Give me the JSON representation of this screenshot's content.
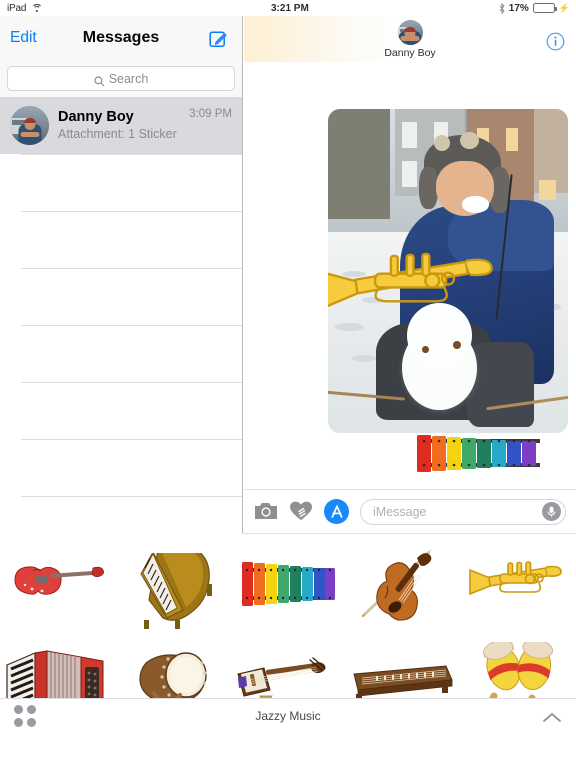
{
  "statusbar": {
    "device": "iPad",
    "wifi_icon": "wifi-icon",
    "time": "3:21 PM",
    "bluetooth_icon": "bluetooth-icon",
    "battery_percent": "17%",
    "battery_level": 17,
    "battery_icon": "battery-icon",
    "charging_icon": "lightning-bolt-icon"
  },
  "sidebar": {
    "edit_label": "Edit",
    "title": "Messages",
    "compose_icon": "compose-icon",
    "search": {
      "placeholder": "Search",
      "icon": "search-icon"
    },
    "conversations": [
      {
        "name": "Danny Boy",
        "preview": "Attachment: 1 Sticker",
        "time": "3:09 PM",
        "selected": true
      }
    ],
    "empty_row_count": 7
  },
  "conversation": {
    "contact_name": "Danny Boy",
    "avatar_icon": "avatar",
    "info_icon": "info-icon",
    "messages": [
      {
        "type": "photo",
        "description": "photo-with-trumpet-sticker"
      },
      {
        "type": "sticker",
        "description": "xylophone-sticker"
      }
    ],
    "input_bar": {
      "camera_icon": "camera-icon",
      "digital_touch_icon": "digital-touch-icon",
      "app_store_icon": "app-store-icon",
      "placeholder": "iMessage",
      "value": "",
      "mic_icon": "microphone-icon"
    }
  },
  "sticker_tray": {
    "title": "Jazzy Music",
    "grid_icon": "app-drawer-grid-icon",
    "collapse_icon": "chevron-up-icon",
    "stickers": [
      {
        "name": "electric-guitar"
      },
      {
        "name": "grand-piano"
      },
      {
        "name": "xylophone"
      },
      {
        "name": "violin"
      },
      {
        "name": "trumpet"
      },
      {
        "name": "accordion"
      },
      {
        "name": "taiko-drum"
      },
      {
        "name": "shamisen"
      },
      {
        "name": "koto"
      },
      {
        "name": "maracas"
      }
    ]
  },
  "colors": {
    "accent_blue": "#0b7cf8",
    "app_store_blue": "#1989fa",
    "battery_green": "#4cd964",
    "selected_row": "#d9d9de",
    "separator": "#dcdcdf"
  }
}
